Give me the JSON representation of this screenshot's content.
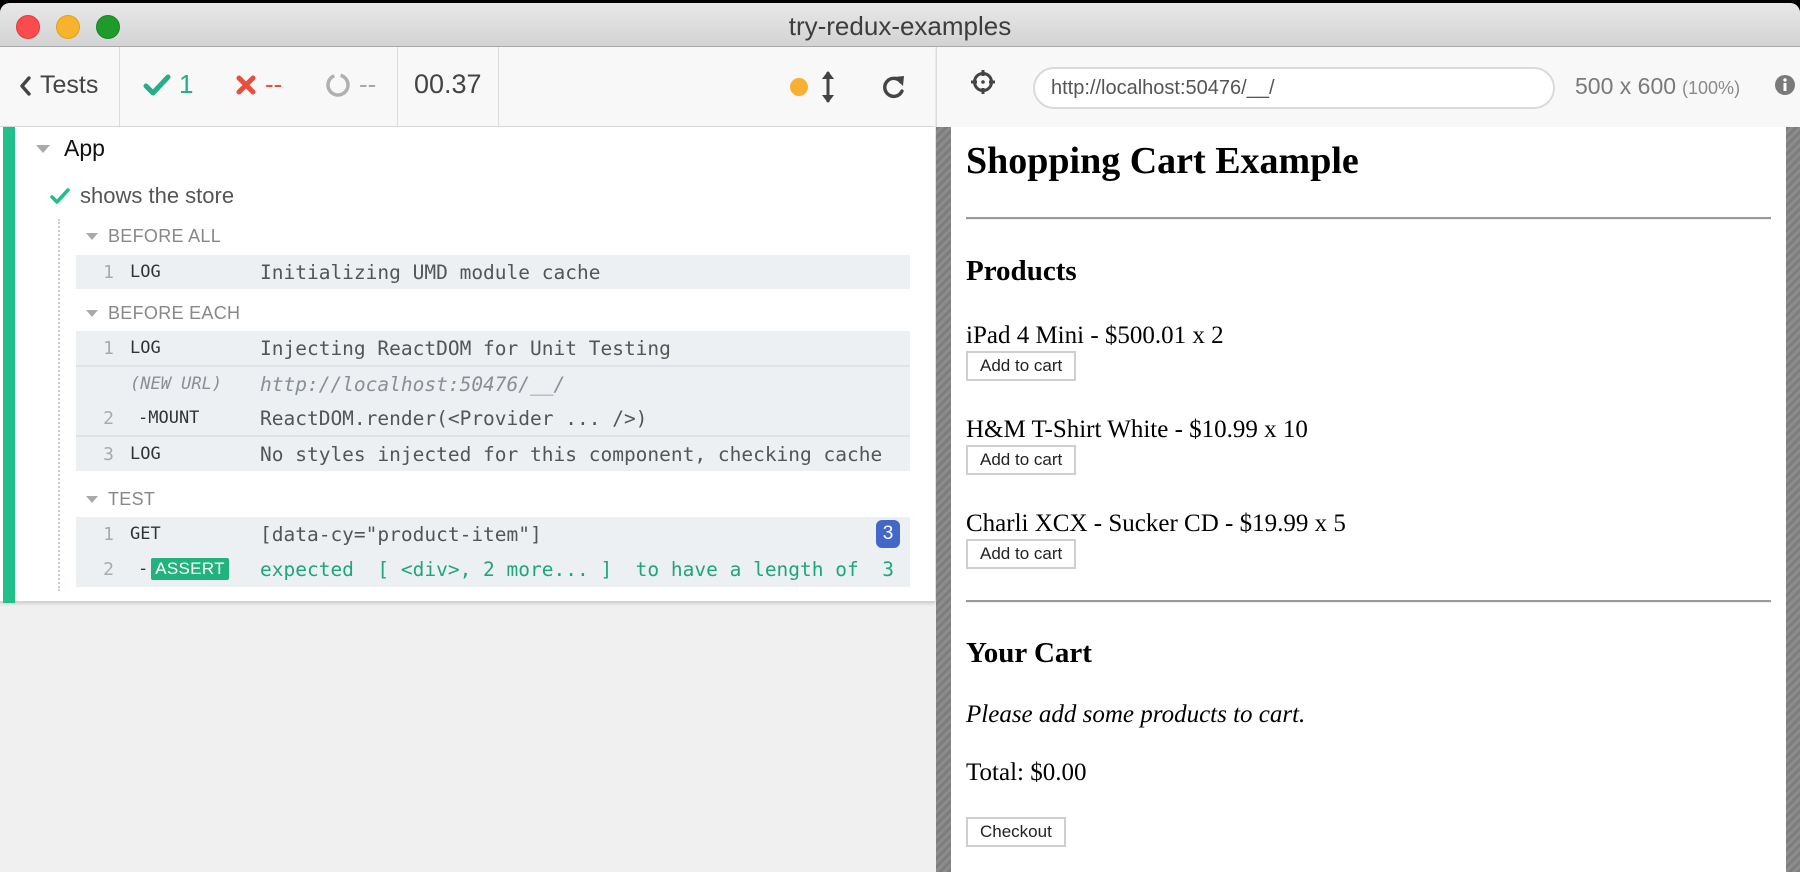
{
  "window": {
    "title": "try-redux-examples"
  },
  "reporter": {
    "tests_label": "Tests",
    "stats": {
      "passed": "1",
      "failed": "--",
      "pending": "--"
    },
    "duration": "00.37",
    "colors": {
      "passed": "#27ad87",
      "failed": "#e94f3e",
      "pending": "#a8a8a8",
      "running": "#f8b032",
      "badge": "#4468c8"
    }
  },
  "aut_header": {
    "url": "http://localhost:50476/__/",
    "viewport_size": "500 x 600",
    "viewport_scale": "(100%)"
  },
  "log": {
    "suite": "App",
    "test": "shows the store",
    "hooks": [
      {
        "title": "BEFORE ALL",
        "commands": [
          {
            "num": "1",
            "name": "LOG",
            "message": "Initializing UMD module cache"
          }
        ]
      },
      {
        "title": "BEFORE EACH",
        "commands": [
          {
            "num": "1",
            "name": "LOG",
            "message": "Injecting ReactDOM for Unit Testing"
          },
          {
            "num": "",
            "name": "(NEW URL)",
            "message": "http://localhost:50476/__/"
          },
          {
            "num": "2",
            "name": "-MOUNT",
            "message": "ReactDOM.render(<Provider ... />)"
          },
          {
            "num": "3",
            "name": "LOG",
            "message": "No styles injected for this component, checking cache"
          }
        ]
      },
      {
        "title": "TEST",
        "commands": [
          {
            "num": "1",
            "name": "GET",
            "message": "[data-cy=\"product-item\"]",
            "badge": "3"
          },
          {
            "num": "2",
            "name": "ASSERT",
            "name_prefix": "-",
            "message": "expected  [ <div>, 2 more... ]  to have a length of  3"
          }
        ]
      }
    ]
  },
  "app": {
    "title": "Shopping Cart Example",
    "products_heading": "Products",
    "products": [
      {
        "label": "iPad 4 Mini - $500.01 x 2",
        "button": "Add to cart"
      },
      {
        "label": "H&M T-Shirt White - $10.99 x 10",
        "button": "Add to cart"
      },
      {
        "label": "Charli XCX - Sucker CD - $19.99 x 5",
        "button": "Add to cart"
      }
    ],
    "cart_heading": "Your Cart",
    "empty_message": "Please add some products to cart.",
    "total": "Total: $0.00",
    "checkout": "Checkout"
  }
}
